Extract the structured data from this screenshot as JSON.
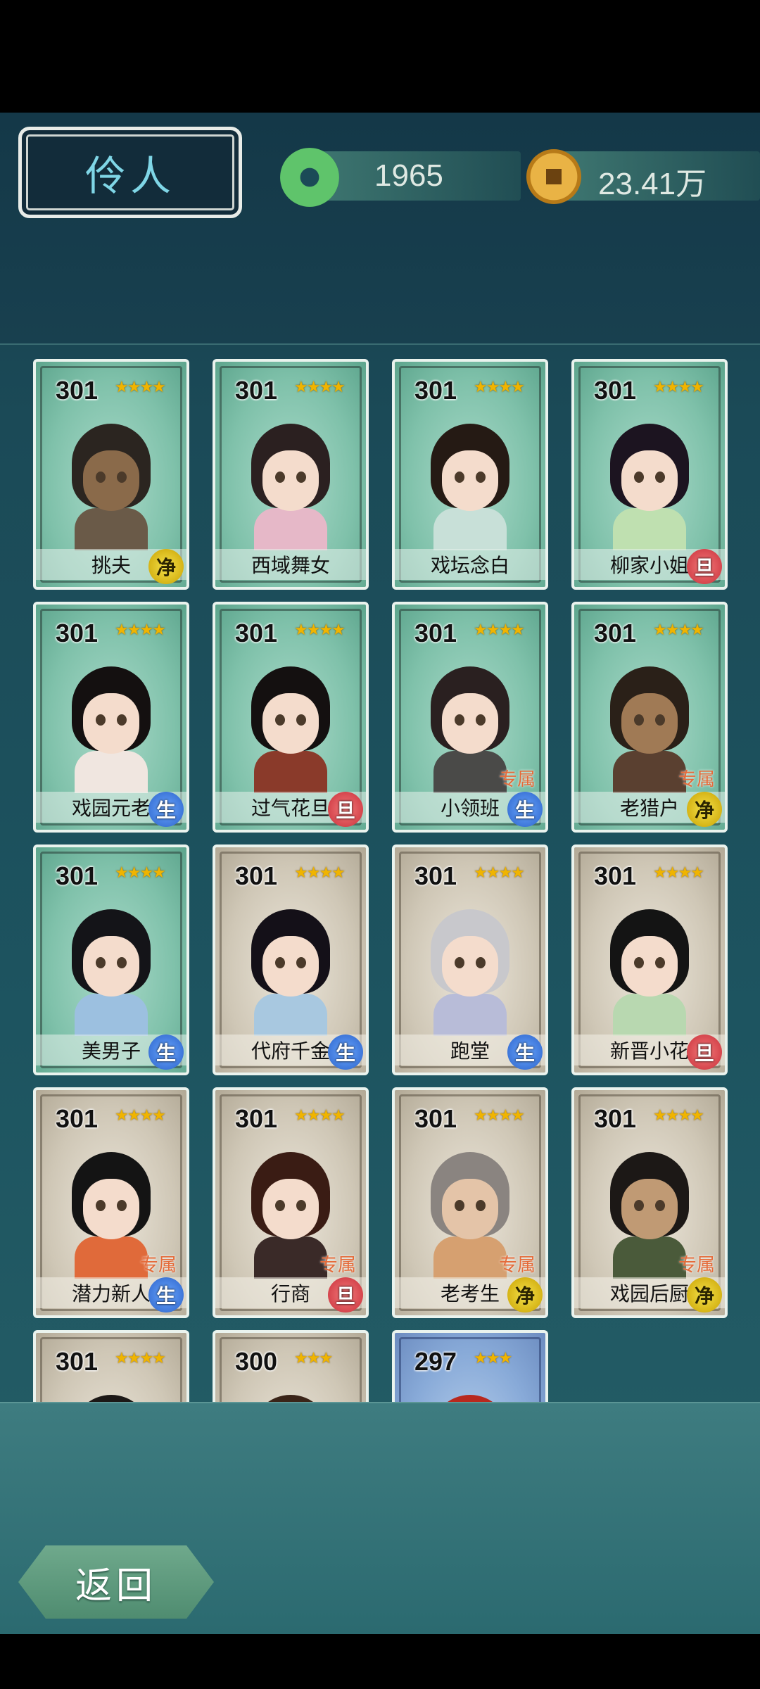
{
  "header": {
    "title": "伶人",
    "jade_amount": "1965",
    "coin_amount": "23.41万"
  },
  "cards": [
    {
      "level": "301",
      "stars": "★★★★",
      "name": "挑夫",
      "badge": "净",
      "badge_type": "jing",
      "zhuan": "",
      "theme": "green",
      "hair": "#2b2520",
      "skin": "#8a6a4a",
      "cloth": "#6a5a48"
    },
    {
      "level": "301",
      "stars": "★★★★",
      "name": "西域舞女",
      "badge": "",
      "badge_type": "",
      "zhuan": "",
      "theme": "green",
      "hair": "#2b2020",
      "skin": "#f4dccc",
      "cloth": "#e6b8c8"
    },
    {
      "level": "301",
      "stars": "★★★★",
      "name": "戏坛念白",
      "badge": "",
      "badge_type": "",
      "zhuan": "",
      "theme": "green",
      "hair": "#251a14",
      "skin": "#f4dccc",
      "cloth": "#c8e0d8"
    },
    {
      "level": "301",
      "stars": "★★★★",
      "name": "柳家小姐",
      "badge": "旦",
      "badge_type": "dan",
      "zhuan": "",
      "theme": "green",
      "hair": "#1c1420",
      "skin": "#f4dccc",
      "cloth": "#bfe0b0"
    },
    {
      "level": "301",
      "stars": "★★★★",
      "name": "戏园元老",
      "badge": "生",
      "badge_type": "sheng",
      "zhuan": "",
      "theme": "green",
      "hair": "#141010",
      "skin": "#f4dccc",
      "cloth": "#f0e6e0"
    },
    {
      "level": "301",
      "stars": "★★★★",
      "name": "过气花旦",
      "badge": "旦",
      "badge_type": "dan",
      "zhuan": "",
      "theme": "green",
      "hair": "#141010",
      "skin": "#f4dccc",
      "cloth": "#8a3a2a"
    },
    {
      "level": "301",
      "stars": "★★★★",
      "name": "小领班",
      "badge": "生",
      "badge_type": "sheng",
      "zhuan": "专属",
      "theme": "green",
      "hair": "#2a2020",
      "skin": "#f4dccc",
      "cloth": "#4a4a48"
    },
    {
      "level": "301",
      "stars": "★★★★",
      "name": "老猎户",
      "badge": "净",
      "badge_type": "jing",
      "zhuan": "专属",
      "theme": "green",
      "hair": "#2a2018",
      "skin": "#a07a55",
      "cloth": "#5a4030"
    },
    {
      "level": "301",
      "stars": "★★★★",
      "name": "美男子",
      "badge": "生",
      "badge_type": "sheng",
      "zhuan": "",
      "theme": "green",
      "hair": "#141418",
      "skin": "#f4dccc",
      "cloth": "#9cc0e0"
    },
    {
      "level": "301",
      "stars": "★★★★",
      "name": "代府千金",
      "badge": "生",
      "badge_type": "sheng",
      "zhuan": "",
      "theme": "grey",
      "hair": "#141018",
      "skin": "#f4dccc",
      "cloth": "#a8c8e0"
    },
    {
      "level": "301",
      "stars": "★★★★",
      "name": "跑堂",
      "badge": "生",
      "badge_type": "sheng",
      "zhuan": "",
      "theme": "grey",
      "hair": "#c8c8cc",
      "skin": "#f4dccc",
      "cloth": "#b8bcd8"
    },
    {
      "level": "301",
      "stars": "★★★★",
      "name": "新晋小花",
      "badge": "旦",
      "badge_type": "dan",
      "zhuan": "",
      "theme": "grey",
      "hair": "#141414",
      "skin": "#f4dccc",
      "cloth": "#b8d8b0"
    },
    {
      "level": "301",
      "stars": "★★★★",
      "name": "潜力新人",
      "badge": "生",
      "badge_type": "sheng",
      "zhuan": "专属",
      "theme": "grey",
      "hair": "#141414",
      "skin": "#f4dccc",
      "cloth": "#e06a3a"
    },
    {
      "level": "301",
      "stars": "★★★★",
      "name": "行商",
      "badge": "旦",
      "badge_type": "dan",
      "zhuan": "专属",
      "theme": "grey",
      "hair": "#3a1c14",
      "skin": "#f4dccc",
      "cloth": "#3a2a28"
    },
    {
      "level": "301",
      "stars": "★★★★",
      "name": "老考生",
      "badge": "净",
      "badge_type": "jing",
      "zhuan": "专属",
      "theme": "grey",
      "hair": "#8a8480",
      "skin": "#e4c4a8",
      "cloth": "#d6a070"
    },
    {
      "level": "301",
      "stars": "★★★★",
      "name": "戏园后厨",
      "badge": "净",
      "badge_type": "jing",
      "zhuan": "专属",
      "theme": "grey",
      "hair": "#1c1816",
      "skin": "#c09a74",
      "cloth": "#4a5a3a"
    },
    {
      "level": "301",
      "stars": "★★★★",
      "name": "",
      "badge": "",
      "badge_type": "",
      "zhuan": "",
      "theme": "grey",
      "hair": "#1c1816",
      "skin": "#f4dccc",
      "cloth": "#888"
    },
    {
      "level": "300",
      "stars": "★★★",
      "name": "",
      "badge": "",
      "badge_type": "",
      "zhuan": "",
      "theme": "grey",
      "hair": "#3a2418",
      "skin": "#f4dccc",
      "cloth": "#888"
    },
    {
      "level": "297",
      "stars": "★★★",
      "name": "",
      "badge": "",
      "badge_type": "",
      "zhuan": "",
      "theme": "blue",
      "hair": "#b8281e",
      "skin": "#f4dccc",
      "cloth": "#888"
    }
  ],
  "footer": {
    "back_label": "返回"
  }
}
